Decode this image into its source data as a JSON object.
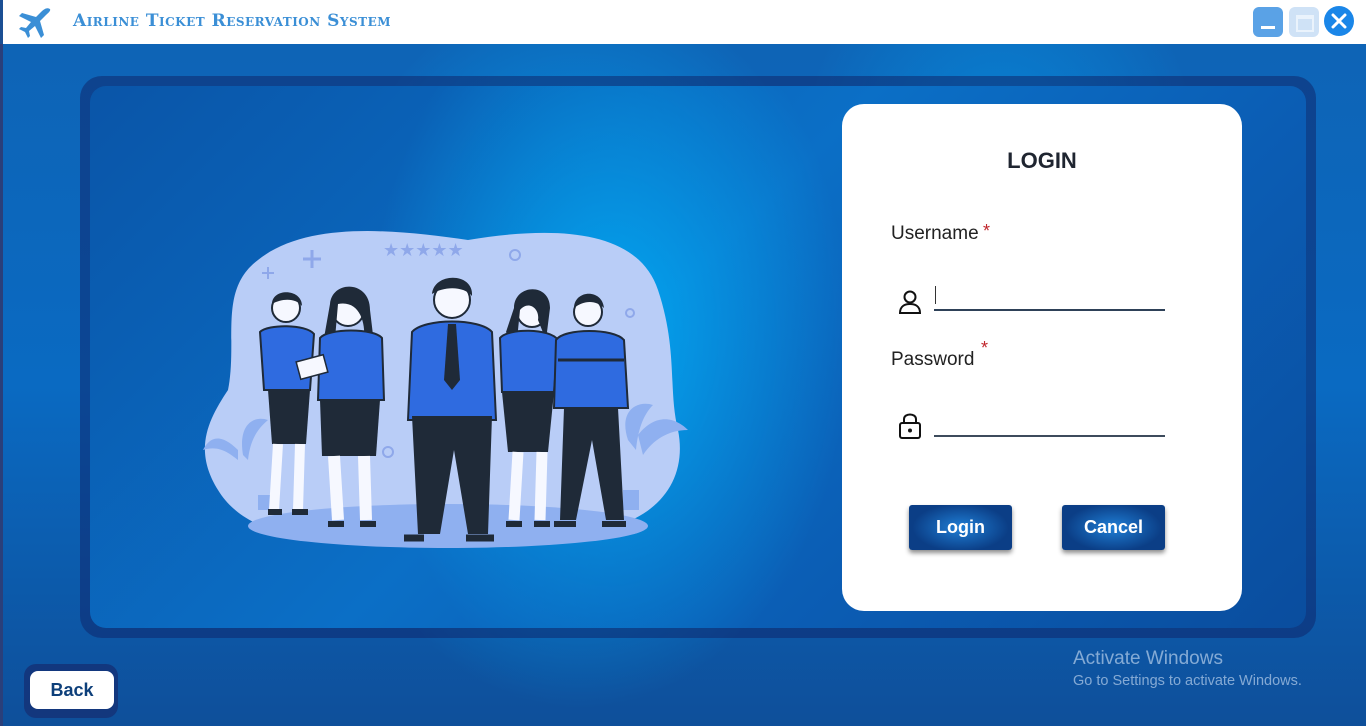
{
  "window": {
    "title": "Airline Ticket Reservation System",
    "icon": "airplane-icon",
    "controls": [
      "minimize-icon",
      "maximize-icon",
      "close-icon"
    ]
  },
  "login": {
    "title": "LOGIN",
    "username_label": "Username",
    "username_required": "*",
    "username_value": "",
    "username_icon": "user-icon",
    "password_label": "Password",
    "password_required": "*",
    "password_value": "",
    "password_icon": "lock-icon",
    "login_button": "Login",
    "cancel_button": "Cancel"
  },
  "back_button": "Back",
  "illustration": "business-team-illustration",
  "watermark": {
    "line1": "Activate Windows",
    "line2": "Go to Settings to activate Windows."
  },
  "colors": {
    "accent": "#1a86e8",
    "button_dark": "#0b3e86",
    "title_text": "#3b8fd6",
    "required": "#c0262c"
  }
}
